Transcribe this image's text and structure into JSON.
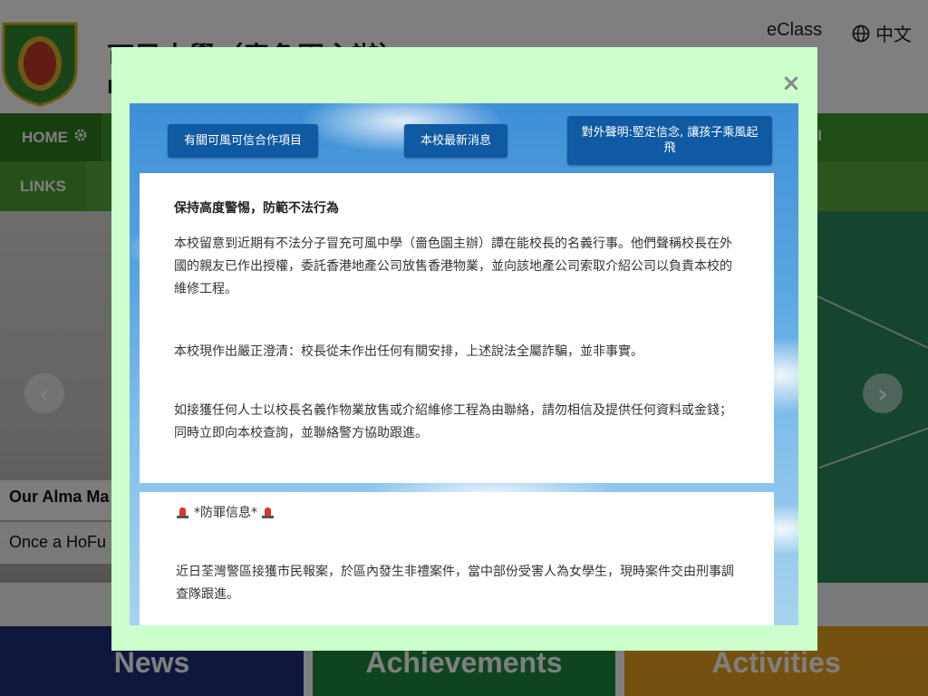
{
  "header": {
    "site_title": "可風中學（嗇色園主辦）",
    "site_subtitle": "H",
    "eclass_label": "eClass",
    "language_label": "中文"
  },
  "nav": {
    "home_label": "HOME",
    "alumni_label": "NI",
    "links_label": "LINKS"
  },
  "hero": {
    "caption_title": "Our Alma Ma",
    "caption_text": "Once a HoFu"
  },
  "tiles": {
    "news": "News",
    "achievements": "Achievements",
    "activities": "Activities"
  },
  "modal": {
    "close_label": "×",
    "buttons": [
      "有關可風可信合作項目",
      "本校最新消息",
      "對外聲明:堅定信念, 讓孩子乘風起飛"
    ],
    "notice": {
      "heading": "保持高度警惕，防範不法行為",
      "paragraphs": [
        "本校留意到近期有不法分子冒充可風中學（嗇色園主辦）譚在能校長的名義行事。他們聲稱校長在外國的親友已作出授權，委託香港地產公司放售香港物業，並向該地產公司索取介紹公司以負責本校的維修工程。",
        "本校現作出嚴正澄清：校長從未作出任何有關安排，上述說法全屬詐騙，並非事實。",
        "如接獲任何人士以校長名義作物業放售或介紹維修工程為由聯絡，請勿相信及提供任何資料或金錢；同時立即向本校查詢，並聯絡警方協助跟進。"
      ]
    },
    "crime": {
      "title": "*防罪信息*",
      "paragraph": "近日荃灣警區接獲市民報案，於區內發生非禮案件，當中部份受害人為女學生，現時案件交由刑事調查隊跟進。"
    }
  },
  "colors": {
    "modal_bg": "#ccffcc",
    "button_blue": "#0f5aa3",
    "nav_green": "#3e9a2c"
  }
}
